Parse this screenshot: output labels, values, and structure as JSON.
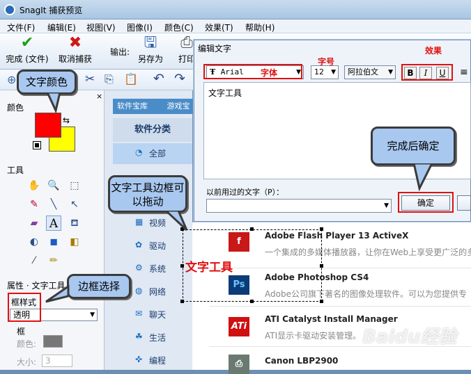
{
  "window": {
    "title": "SnagIt 捕获预览"
  },
  "menu": [
    "文件(F)",
    "编辑(E)",
    "视图(V)",
    "图像(I)",
    "颜色(C)",
    "效果(T)",
    "帮助(H)"
  ],
  "ribbon": {
    "finish": "完成 (文件)",
    "cancel": "取消捕获",
    "output_label": "输出:",
    "saveas": "另存为",
    "print": "打印"
  },
  "left": {
    "color_label": "颜色",
    "tools_label": "工具",
    "props_label": "属性 · 文字工具",
    "frame_style_label": "框样式",
    "frame_style_value": "透明",
    "frame_label": "框",
    "frame_color_label": "颜色:",
    "size_label": "大小:",
    "size_value": "3"
  },
  "categories": {
    "library": "软件宝库",
    "games": "游戏宝",
    "heading": "软件分类",
    "items": [
      "全部",
      "视频",
      "驱动",
      "系统",
      "网络",
      "聊天",
      "生活",
      "编程"
    ]
  },
  "software": [
    {
      "name": "Adobe Flash Player 13 ActiveX",
      "desc": "一个集成的多媒体播放器，让你在Web上享受更广泛的多"
    },
    {
      "name": "Adobe Photoshop CS4",
      "desc": "Adobe公司旗下著名的图像处理软件。可以为您提供专"
    },
    {
      "name": "ATI Catalyst Install Manager",
      "desc": "ATI显示卡驱动安装管理。"
    },
    {
      "name": "Canon LBP2900",
      "desc": ""
    }
  ],
  "dialog": {
    "title": "编辑文字",
    "font": "Arial",
    "font_annotation": "字体",
    "size_annotation": "字号",
    "size": "12",
    "script": "阿拉伯文",
    "effect_annotation": "效果",
    "bold": "B",
    "italic": "I",
    "underline": "U",
    "text": "文字工具",
    "history_label": "以前用过的文字（P）：",
    "ok": "确定"
  },
  "canvas_text": "文字工具",
  "callouts": {
    "text_color": "文字颜色",
    "drag_frame": "文字工具边框可以拖动",
    "frame_select": "边框选择",
    "confirm": "完成后确定"
  },
  "colors": {
    "foreground": "#ff0000",
    "background": "#ffff00",
    "annotation": "#e01010",
    "bubble": "#a9c8f0"
  },
  "watermark": "Baidu经验"
}
